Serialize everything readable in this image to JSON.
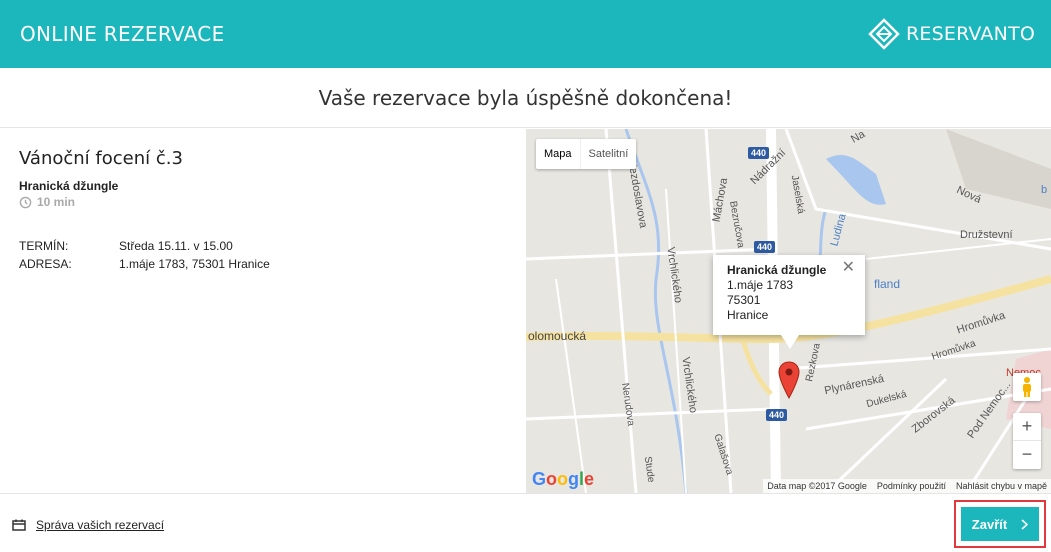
{
  "header": {
    "title": "ONLINE REZERVACE",
    "logo_text": "RESERVANTO"
  },
  "success_message": "Vaše rezervace byla úspěšně dokončena!",
  "reservation": {
    "service": "Vánoční focení č.3",
    "place": "Hranická džungle",
    "duration": "10 min",
    "rows": [
      {
        "label": "TERMÍN:",
        "value": "Středa 15.11. v 15.00"
      },
      {
        "label": "ADRESA:",
        "value": "1.máje 1783, 75301 Hranice"
      }
    ]
  },
  "map": {
    "type_buttons": [
      "Mapa",
      "Satelitní"
    ],
    "bubble": {
      "title": "Hranická džungle",
      "lines": [
        "1.máje 1783",
        "75301",
        "Hranice"
      ]
    },
    "labels": {
      "hviezdoslavova": "Hviezdoslavova",
      "vrchlickeho1": "Vrchlického",
      "vrchlickeho2": "Vrchlického",
      "machova": "Máchova",
      "bezrucova": "Bezručova",
      "nadrazni": "Nádražní",
      "jaselska": "Jaselská",
      "ludina": "Ludina",
      "nova": "Nová",
      "druzstevni": "Družstevní",
      "olomoucka": "olomoucká",
      "lidl": "fland",
      "rezkova": "Rezkova",
      "hromuvka1": "Hromůvka",
      "hromuvka2": "Hromůvka",
      "plynarenska": "Plynárenská",
      "dukelska": "Dukelská",
      "zborovska": "Zborovská",
      "pod_nemocnici": "Pod Nemoc...",
      "nemocnice": "Nemoc",
      "nerudova": "Nerudova",
      "galasova": "Galašova",
      "studentska": "Stude",
      "b": "b",
      "na": "Na"
    },
    "shields": [
      "440",
      "440",
      "440"
    ],
    "zoom_in": "+",
    "zoom_out": "−",
    "attribution": [
      "Data map ©2017 Google",
      "Podmínky použití",
      "Nahlásit chybu v mapě"
    ],
    "google": "Google"
  },
  "footer": {
    "manage_link": "Správa vašich rezervací",
    "close_label": "Zavřít"
  }
}
